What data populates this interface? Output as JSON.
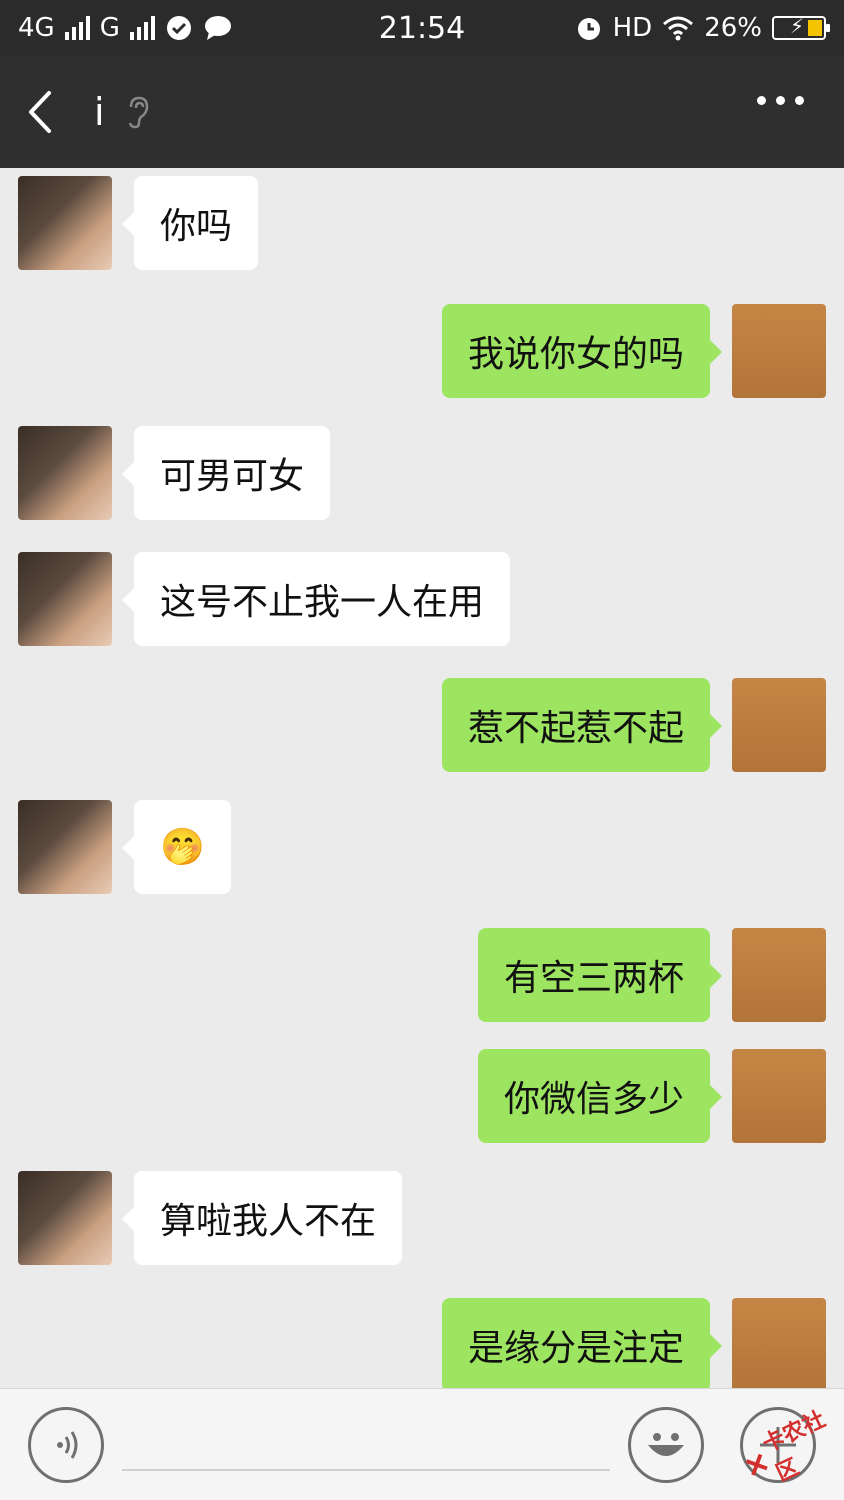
{
  "status_bar": {
    "network_left": "4G",
    "network_right": "G",
    "time": "21:54",
    "hd": "HD",
    "battery": "26%"
  },
  "header": {
    "back_icon": "chevron-left-icon",
    "title": "i",
    "ear_icon": "ear-icon",
    "more_icon": "more-dots-icon"
  },
  "messages": [
    {
      "side": "left",
      "text": "你吗"
    },
    {
      "side": "right",
      "text": "我说你女的吗"
    },
    {
      "side": "left",
      "text": "可男可女"
    },
    {
      "side": "left",
      "text": "这号不止我一人在用"
    },
    {
      "side": "right",
      "text": "惹不起惹不起"
    },
    {
      "side": "left",
      "text": "🤭"
    },
    {
      "side": "right",
      "text": "有空三两杯"
    },
    {
      "side": "right",
      "text": "你微信多少"
    },
    {
      "side": "left",
      "text": "算啦我人不在"
    },
    {
      "side": "right",
      "text": "是缘分是注定"
    }
  ],
  "input_bar": {
    "voice_icon": "voice-icon",
    "emoji_icon": "emoji-icon",
    "plus_icon": "plus-icon",
    "input_value": ""
  },
  "watermark": {
    "text": "卡农社区"
  },
  "colors": {
    "status_bg": "#2b2b2b",
    "header_bg": "#2f2f2f",
    "chat_bg": "#ebebeb",
    "bubble_self": "#9de461",
    "bubble_other": "#ffffff"
  }
}
